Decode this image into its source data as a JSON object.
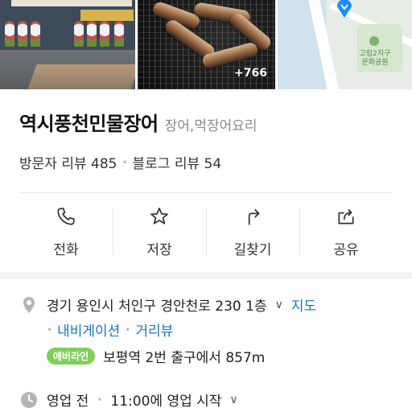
{
  "photos": {
    "more_count": "+766",
    "map_label": "고림2지구\n문화공원"
  },
  "place": {
    "name": "역시풍천민물장어",
    "category": "장어,먹장어요리"
  },
  "reviews": {
    "visitor": "방문자 리뷰 485",
    "blog": "블로그 리뷰 54"
  },
  "actions": [
    {
      "label": "전화",
      "icon": "phone-icon"
    },
    {
      "label": "저장",
      "icon": "star-icon"
    },
    {
      "label": "길찾기",
      "icon": "directions-icon"
    },
    {
      "label": "공유",
      "icon": "share-icon"
    }
  ],
  "address": {
    "text": "경기 용인시 처인구 경안천로 230 1층",
    "map_link": "지도",
    "nav_link": "내비게이션",
    "street_link": "거리뷰"
  },
  "transit": {
    "line_badge": "에버라인",
    "text": "보평역 2번 출구에서 857m"
  },
  "hours": {
    "status": "영업 전",
    "text": "11:00에 영업 시작"
  },
  "colors": {
    "link": "#1a73c8",
    "badge": "#7fcf5a"
  }
}
